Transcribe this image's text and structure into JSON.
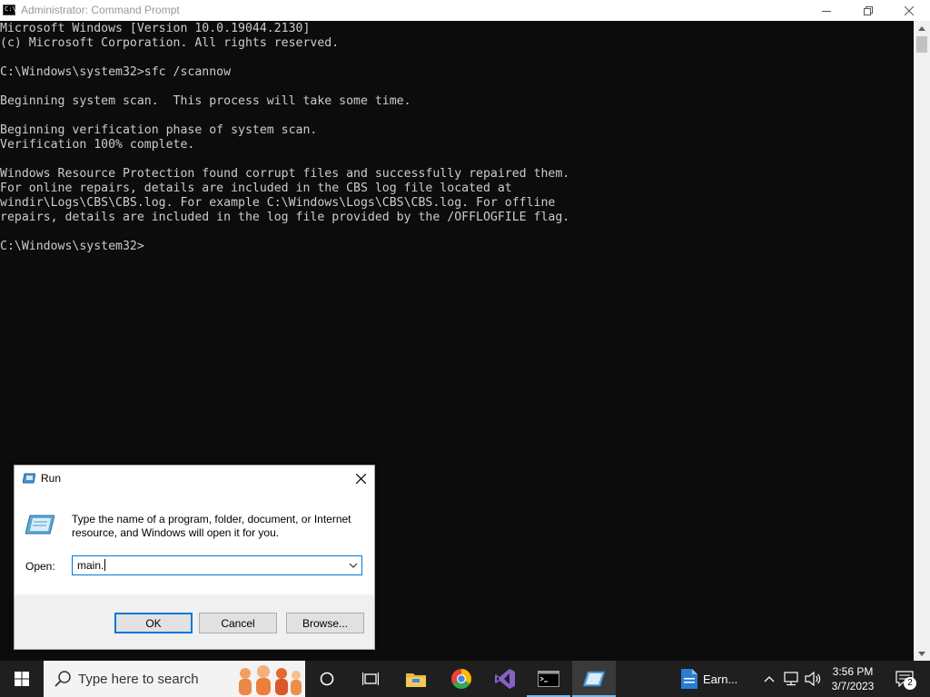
{
  "window": {
    "title": "Administrator: Command Prompt",
    "icon": "console-icon",
    "icon_text": "C:\\"
  },
  "console": {
    "text": "Microsoft Windows [Version 10.0.19044.2130]\n(c) Microsoft Corporation. All rights reserved.\n\nC:\\Windows\\system32>sfc /scannow\n\nBeginning system scan.  This process will take some time.\n\nBeginning verification phase of system scan.\nVerification 100% complete.\n\nWindows Resource Protection found corrupt files and successfully repaired them.\nFor online repairs, details are included in the CBS log file located at\nwindir\\Logs\\CBS\\CBS.log. For example C:\\Windows\\Logs\\CBS\\CBS.log. For offline\nrepairs, details are included in the log file provided by the /OFFLOGFILE flag.\n\nC:\\Windows\\system32>"
  },
  "run_dialog": {
    "title": "Run",
    "description": "Type the name of a program, folder, document, or Internet resource, and Windows will open it for you.",
    "open_label": "Open:",
    "input_value": "main.",
    "ok_label": "OK",
    "cancel_label": "Cancel",
    "browse_label": "Browse..."
  },
  "taskbar": {
    "search_placeholder": "Type here to search",
    "pinned": [
      "start-icon",
      "cortana-icon",
      "task-view-icon",
      "file-explorer-icon",
      "chrome-icon",
      "visual-studio-icon",
      "command-prompt-icon",
      "run-icon"
    ],
    "earn_label": "Earn...",
    "time": "3:56 PM",
    "date": "3/7/2023",
    "notification_count": "2"
  },
  "colors": {
    "console_bg": "#0c0c0c",
    "console_fg": "#cccccc",
    "accent": "#0078d7",
    "taskbar": "#1f1f1f"
  }
}
